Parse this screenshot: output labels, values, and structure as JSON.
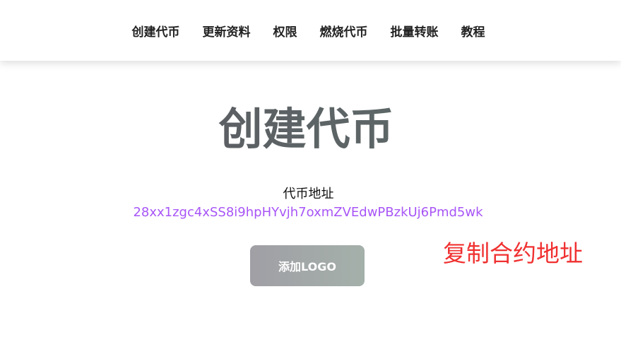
{
  "nav": {
    "items": [
      "创建代币",
      "更新资料",
      "权限",
      "燃烧代币",
      "批量转账",
      "教程"
    ]
  },
  "main": {
    "title": "创建代币",
    "address_label": "代币地址",
    "address": "28xx1zgc4xSS8i9hpHYvjh7oxmZVEdwPBzkUj6Pmd5wk",
    "add_logo_label": "添加LOGO",
    "copy_annotation": "复制合约地址"
  }
}
